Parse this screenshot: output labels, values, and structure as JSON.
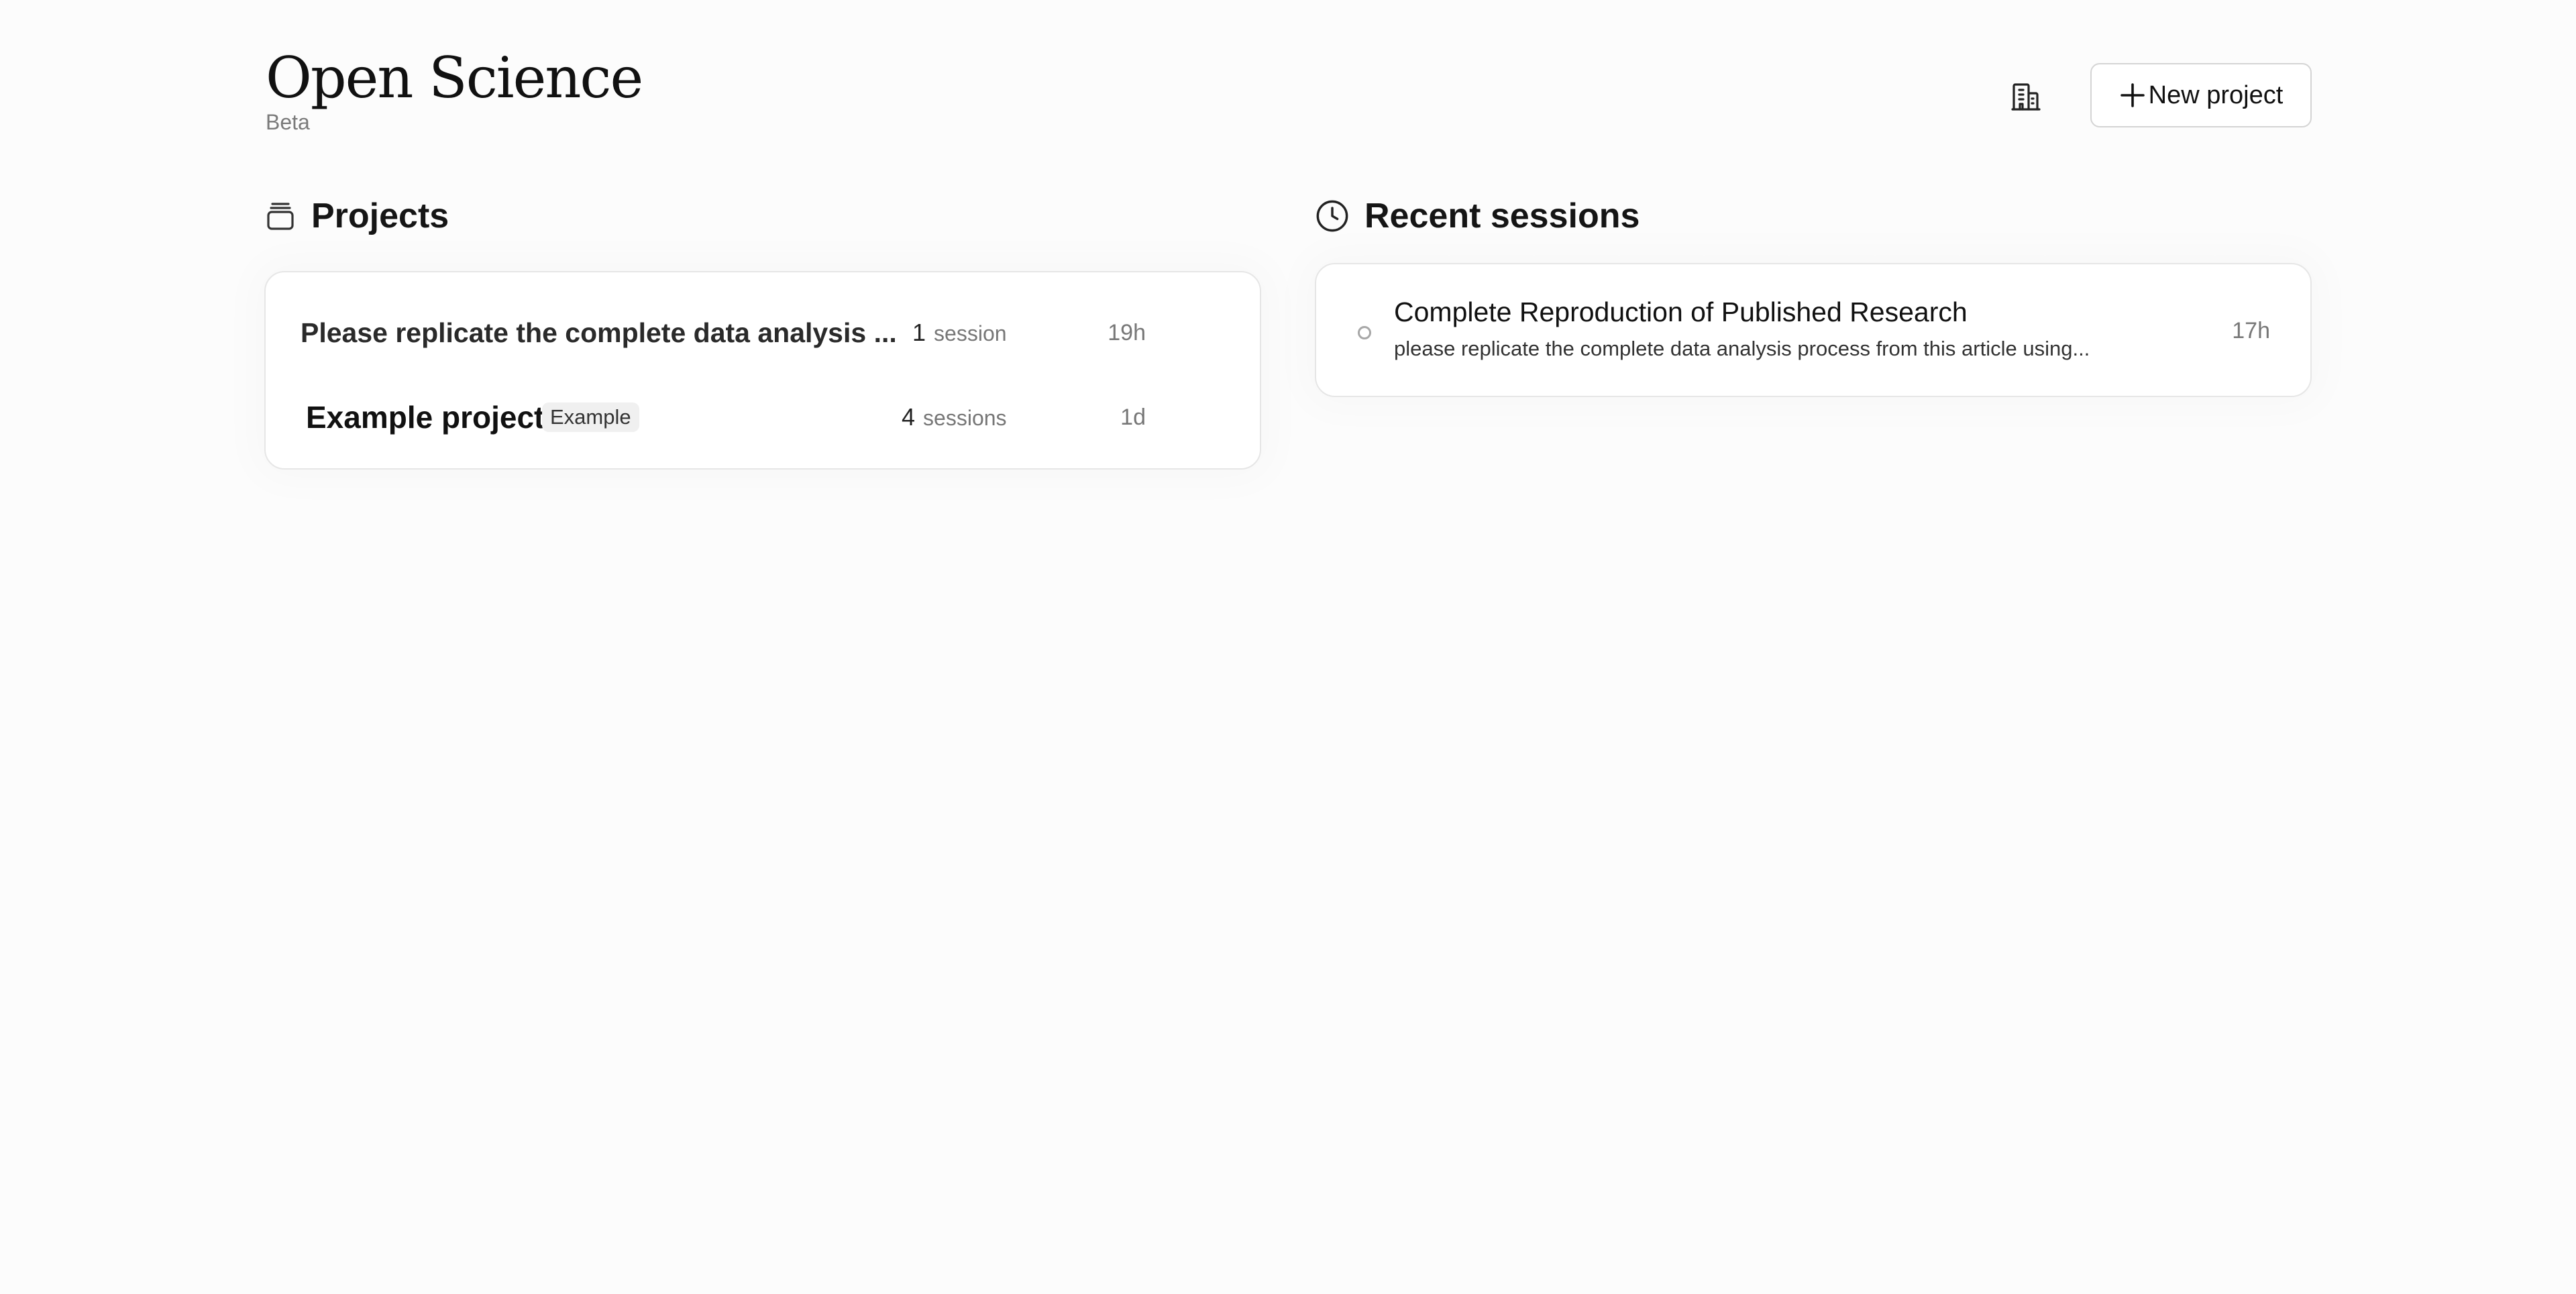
{
  "header": {
    "title": "Open Science",
    "subtitle": "Beta",
    "org_icon": "building-icon",
    "new_project_label": "New project"
  },
  "projects": {
    "heading": "Projects",
    "icon": "stack-icon",
    "items": [
      {
        "name": "Please replicate the complete data analysis ...",
        "badge": "",
        "count": "1",
        "count_label": "session",
        "age": "19h"
      },
      {
        "name": "Example project",
        "badge": "Example",
        "count": "4",
        "count_label": "sessions",
        "age": "1d"
      }
    ]
  },
  "sessions": {
    "heading": "Recent sessions",
    "icon": "clock-icon",
    "items": [
      {
        "title": "Complete Reproduction of Published Research",
        "description": "please replicate the complete data analysis process from this article using...",
        "age": "17h",
        "status_icon": "status-dot-icon"
      }
    ]
  }
}
